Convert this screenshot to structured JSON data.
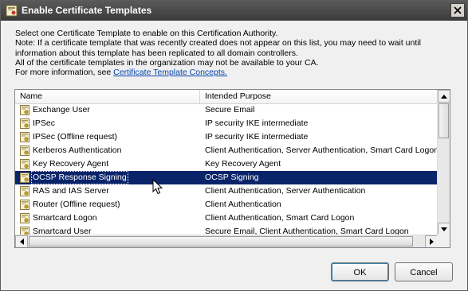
{
  "window": {
    "title": "Enable Certificate Templates"
  },
  "description": {
    "line1": "Select one Certificate Template to enable on this Certification Authority.",
    "line2": "Note: If a certificate template that was recently created does not appear on this list, you may need to wait until",
    "line3": "information about this template has been replicated to all domain controllers.",
    "line4": "All of the certificate templates in the organization may not be available to your CA.",
    "line5_prefix": "For more information, see ",
    "link": "Certificate Template Concepts."
  },
  "list": {
    "columns": {
      "name": "Name",
      "purpose": "Intended Purpose"
    },
    "rows": [
      {
        "name": "Exchange User",
        "purpose": "Secure Email"
      },
      {
        "name": "IPSec",
        "purpose": "IP security IKE intermediate"
      },
      {
        "name": "IPSec (Offline request)",
        "purpose": "IP security IKE intermediate"
      },
      {
        "name": "Kerberos Authentication",
        "purpose": "Client Authentication, Server Authentication, Smart Card Logon"
      },
      {
        "name": "Key Recovery Agent",
        "purpose": "Key Recovery Agent"
      },
      {
        "name": "OCSP Response Signing",
        "purpose": "OCSP Signing",
        "selected": true
      },
      {
        "name": "RAS and IAS Server",
        "purpose": "Client Authentication, Server Authentication"
      },
      {
        "name": "Router (Offline request)",
        "purpose": "Client Authentication"
      },
      {
        "name": "Smartcard Logon",
        "purpose": "Client Authentication, Smart Card Logon"
      },
      {
        "name": "Smartcard User",
        "purpose": "Secure Email, Client Authentication, Smart Card Logon"
      }
    ]
  },
  "buttons": {
    "ok": "OK",
    "cancel": "Cancel"
  },
  "colors": {
    "selection": "#0a246a",
    "link": "#0645ad",
    "titlebar": "#4a4a4a"
  }
}
